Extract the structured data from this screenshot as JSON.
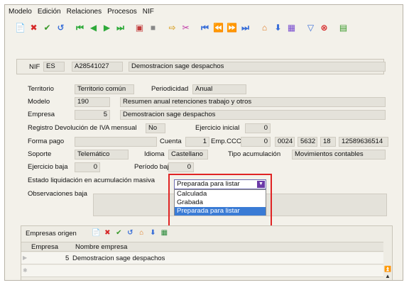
{
  "menu": [
    "Modelo",
    "Edición",
    "Relaciones",
    "Procesos",
    "NIF"
  ],
  "toolbar_icons": [
    {
      "name": "new-icon",
      "glyph": "📄",
      "color": "#666"
    },
    {
      "name": "delete-icon",
      "glyph": "✖",
      "color": "#d62828"
    },
    {
      "name": "accept-icon",
      "glyph": "✔",
      "color": "#3a9a2a"
    },
    {
      "name": "undo-icon",
      "glyph": "↺",
      "color": "#3a6fd8"
    },
    {
      "name": "first-record-icon",
      "glyph": "⏮",
      "color": "#2eaa3a"
    },
    {
      "name": "previous-record-icon",
      "glyph": "◀",
      "color": "#2eaa3a"
    },
    {
      "name": "next-record-icon",
      "glyph": "▶",
      "color": "#2eaa3a"
    },
    {
      "name": "last-record-icon",
      "glyph": "⏭",
      "color": "#2eaa3a"
    },
    {
      "name": "print-icon",
      "glyph": "▣",
      "color": "#c23b3b"
    },
    {
      "name": "stop-icon",
      "glyph": "■",
      "color": "#888"
    },
    {
      "name": "export-icon",
      "glyph": "⇨",
      "color": "#d9a22a"
    },
    {
      "name": "cut-icon",
      "glyph": "✂",
      "color": "#c03aa8"
    },
    {
      "name": "first-page-icon",
      "glyph": "⏮",
      "color": "#3a6fd8"
    },
    {
      "name": "previous-page-icon",
      "glyph": "⏪",
      "color": "#3a6fd8"
    },
    {
      "name": "next-page-icon",
      "glyph": "⏩",
      "color": "#3a6fd8"
    },
    {
      "name": "last-page-icon",
      "glyph": "⏭",
      "color": "#3a6fd8"
    },
    {
      "name": "home-icon",
      "glyph": "⌂",
      "color": "#e07b22"
    },
    {
      "name": "down-arrow-icon",
      "glyph": "⬇",
      "color": "#3a6fd8"
    },
    {
      "name": "report-icon",
      "glyph": "▦",
      "color": "#7a4fd0"
    },
    {
      "name": "filter-icon",
      "glyph": "▽",
      "color": "#3a6fd8"
    },
    {
      "name": "remove-filter-icon",
      "glyph": "⊗",
      "color": "#d62828"
    },
    {
      "name": "calculator-icon",
      "glyph": "▤",
      "color": "#3a9a2a"
    }
  ],
  "header": {
    "nif_label": "NIF",
    "country": "ES",
    "nif": "A28541027",
    "name": "Demostracion sage despachos"
  },
  "form": {
    "territorio_label": "Territorio",
    "territorio": "Territorio común",
    "periodicidad_label": "Periodicidad",
    "periodicidad": "Anual",
    "modelo_label": "Modelo",
    "modelo": "190",
    "modelo_desc": "Resumen anual retenciones trabajo y otros",
    "empresa_label": "Empresa",
    "empresa": "5",
    "empresa_desc": "Demostracion sage despachos",
    "registro_label": "Registro Devolución de IVA mensual",
    "registro": "No",
    "ejercicio_inicial_label": "Ejercicio inicial",
    "ejercicio_inicial": "0",
    "forma_pago_label": "Forma pago",
    "cuenta_label": "Cuenta",
    "cuenta": "1",
    "empccc_label": "Emp.CCC",
    "empccc": "0",
    "ccc1": "0024",
    "ccc2": "5632",
    "ccc3": "18",
    "ccc4": "12589636514",
    "soporte_label": "Soporte",
    "soporte": "Telemático",
    "idioma_label": "Idioma",
    "idioma": "Castellano",
    "tipo_acum_label": "Tipo acumulación",
    "tipo_acum": "Movimientos contables",
    "ejercicio_baja_label": "Ejercicio baja",
    "ejercicio_baja": "0",
    "periodo_baja_label": "Período baja",
    "periodo_baja": "0",
    "estado_label": "Estado liquidación en acumulación masiva",
    "estado_value": "Preparada para listar",
    "estado_options": [
      "Calculada",
      "Grabada",
      "Preparada para listar"
    ],
    "observaciones_label": "Observaciones baja"
  },
  "subpanel": {
    "title": "Empresas origen",
    "icons": [
      {
        "name": "new-icon",
        "glyph": "📄",
        "color": "#666"
      },
      {
        "name": "delete-icon",
        "glyph": "✖",
        "color": "#d62828"
      },
      {
        "name": "accept-icon",
        "glyph": "✔",
        "color": "#3a9a2a"
      },
      {
        "name": "undo-icon",
        "glyph": "↺",
        "color": "#3a6fd8"
      },
      {
        "name": "home-icon",
        "glyph": "⌂",
        "color": "#e07b22"
      },
      {
        "name": "down-arrow-icon",
        "glyph": "⬇",
        "color": "#3a6fd8"
      },
      {
        "name": "excel-icon",
        "glyph": "▦",
        "color": "#2a8a3a"
      }
    ],
    "columns": [
      "Empresa",
      "Nombre empresa"
    ],
    "rows": [
      {
        "empresa": "5",
        "nombre": "Demostracion sage despachos"
      }
    ]
  },
  "colors": {
    "highlight": "#e02424",
    "selected_option": "#3a7bd5",
    "dropdown_arrow": "#6b3aa8"
  }
}
